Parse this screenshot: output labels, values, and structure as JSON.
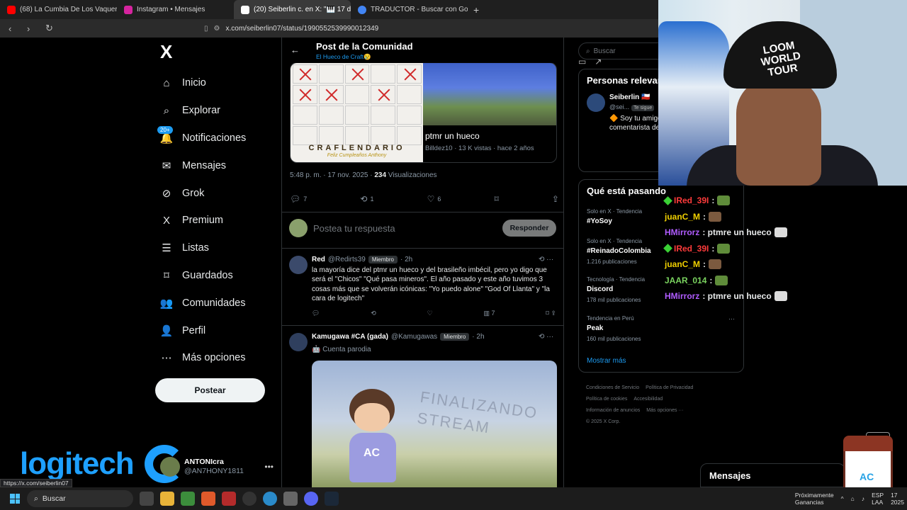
{
  "browser": {
    "tabs": [
      {
        "label": "(68) La Cumbia De Los Vaqueros",
        "favicon_color": "#ff0000"
      },
      {
        "label": "Instagram • Mensajes",
        "favicon_color": "#d6249f"
      },
      {
        "label": "(20) Seiberlin c. en X: \"🎹 17 de",
        "favicon_color": "#ffffff",
        "active": true
      },
      {
        "label": "TRADUCTOR - Buscar con Google",
        "favicon_color": "#4285f4"
      }
    ],
    "url": "x.com/seiberlin07/status/1990552539990012349",
    "status_url": "https://x.com/seiberlin07"
  },
  "leftnav": {
    "logo": "X",
    "items": [
      {
        "label": "Inicio",
        "icon": "home-icon",
        "glyph": "⌂"
      },
      {
        "label": "Explorar",
        "icon": "search-icon",
        "glyph": "⌕"
      },
      {
        "label": "Notificaciones",
        "icon": "bell-icon",
        "glyph": "🔔",
        "badge": "20+"
      },
      {
        "label": "Mensajes",
        "icon": "mail-icon",
        "glyph": "✉"
      },
      {
        "label": "Grok",
        "icon": "grok-icon",
        "glyph": "⊘"
      },
      {
        "label": "Premium",
        "icon": "x-premium-icon",
        "glyph": "X"
      },
      {
        "label": "Listas",
        "icon": "list-icon",
        "glyph": "☰"
      },
      {
        "label": "Guardados",
        "icon": "bookmark-icon",
        "glyph": "⌑"
      },
      {
        "label": "Comunidades",
        "icon": "communities-icon",
        "glyph": "👥"
      },
      {
        "label": "Perfil",
        "icon": "profile-icon",
        "glyph": "👤"
      },
      {
        "label": "Más opciones",
        "icon": "more-icon",
        "glyph": "⋯"
      }
    ],
    "post_button": "Postear",
    "account": {
      "name": "ANTONIcra",
      "handle": "@AN7HONY1811"
    }
  },
  "overlay": {
    "brand": "logitech"
  },
  "main": {
    "header_title": "Post de la Comunidad",
    "header_subtitle": "El Hueco de Craft😢",
    "embed": {
      "banner": "CRAFLENDARIO",
      "banner_sub": "Feliz Cumpleaños Anthony",
      "title": "ptmr un hueco",
      "meta": "Billdez10 · 13 K vistas · hace 2 años"
    },
    "post_meta": {
      "time": "5:48 p. m. · 17 nov. 2025 · ",
      "views": "234",
      "views_label": " Visualizaciones"
    },
    "post_actions": {
      "replies": "7",
      "reposts": "1",
      "likes": "6"
    },
    "reply_placeholder": "Postea tu respuesta",
    "reply_button": "Responder",
    "tweets": [
      {
        "name": "Red",
        "handle": "@Redirts39",
        "tag": "Miembro",
        "time": "· 2h",
        "body": "la mayoría dice del ptmr un hueco y del brasileño imbécil, pero yo digo que será el \"Chicos\" \"Qué pasa mineros\". El año pasado y este año tuvimos 3 cosas más que se volverán icónicas: \"Yo puedo alone\" \"God Of Llanta\" y \"la cara de logitech\"",
        "views": "7"
      },
      {
        "name": "Kamugawa #CA (gada)",
        "handle": "@Kamugawas",
        "tag": "Miembro",
        "time": "· 2h",
        "label": "🤖 Cuenta parodia",
        "image_text": "FINALIZANDO STREAM",
        "image_shirt": "AC"
      }
    ]
  },
  "right": {
    "search_placeholder": "Buscar",
    "people_title": "Personas relevantes",
    "person": {
      "name": "Seiberlin 🇨🇱",
      "handle": "@sei...",
      "follows": "Te sigue",
      "bio": "🔶 Soy tu amigo, vecino, Seiberlin, comentarista de esporadicamente 🔴🇨🇱"
    },
    "trends_title": "Qué está pasando",
    "trends": [
      {
        "context": "Solo en X · Tendencia",
        "name": "#YoSoy",
        "posts": ""
      },
      {
        "context": "Solo en X · Tendencia",
        "name": "#ReinadoColombia",
        "posts": "1.216 publicaciones"
      },
      {
        "context": "Tecnología · Tendencia",
        "name": "Discord",
        "posts": "178 mil publicaciones"
      },
      {
        "context": "Tendencia en Perú",
        "name": "Peak",
        "posts": "160 mil publicaciones"
      }
    ],
    "show_more": "Mostrar más",
    "footer": [
      "Condiciones de Servicio",
      "Política de Privacidad",
      "Política de cookies",
      "Accesibilidad",
      "Información de anuncios",
      "Más opciones ···",
      "© 2025 X Corp."
    ]
  },
  "chat": [
    {
      "user": "IRed_39I",
      "color": "#ff3b3b",
      "msg": " : ",
      "emote": "g",
      "mod": true
    },
    {
      "user": "juanC_M",
      "color": "#f0d000",
      "msg": " : ",
      "emote": "b",
      "mod": false
    },
    {
      "user": "HMirrorz",
      "color": "#b05cff",
      "msg": " : ptmre un hueco ",
      "emote": "w",
      "mod": false
    },
    {
      "user": "IRed_39I",
      "color": "#ff3b3b",
      "msg": " : ",
      "emote": "g",
      "mod": true
    },
    {
      "user": "juanC_M",
      "color": "#f0d000",
      "msg": " : ",
      "emote": "b",
      "mod": false
    },
    {
      "user": "JAAR_014",
      "color": "#7ad35f",
      "msg": " : ",
      "emote": "g",
      "mod": false
    },
    {
      "user": "HMirrorz",
      "color": "#b05cff",
      "msg": " : ptmre un hueco ",
      "emote": "w",
      "mod": false
    }
  ],
  "webcam": {
    "hat_text": "LOOM WORLD TOUR"
  },
  "messages_drawer": "Mensajes",
  "taskbar": {
    "search": "Buscar",
    "notif": "Próximamente",
    "notif2": "Ganancias",
    "lang": "ESP",
    "lang2": "LAA",
    "clock1": "17",
    "clock2": "2025"
  }
}
